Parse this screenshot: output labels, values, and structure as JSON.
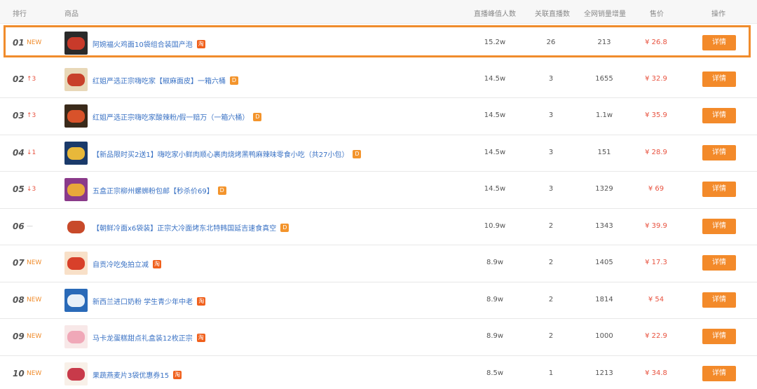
{
  "header": {
    "rank": "排行",
    "product": "商品",
    "peak_viewers": "直播峰值人数",
    "related_lives": "关联直播数",
    "sales_increase": "全网销量增量",
    "price": "售价",
    "action": "操作"
  },
  "detail_label": "详情",
  "colors": {
    "accent": "#f38a2a",
    "highlight_border": "#f08c2c",
    "price": "#e8523f",
    "link": "#3a72c4"
  },
  "rows": [
    {
      "rank": "01",
      "change": "NEW",
      "change_type": "new",
      "name": "阿婉福火鸡面10袋组合装国产泡",
      "badge": "淘",
      "badge_type": "tao",
      "peak": "15.2w",
      "lives": "26",
      "sales": "213",
      "price": "¥ 26.8",
      "thumb": [
        "#2a2a2a",
        "#c83a2a"
      ]
    },
    {
      "rank": "02",
      "change": "↑3",
      "change_type": "up",
      "name": "红姐严选正宗嗨吃家【椒麻面皮】一箱六桶",
      "badge": "D",
      "badge_type": "d",
      "peak": "14.5w",
      "lives": "3",
      "sales": "1655",
      "price": "¥ 32.9",
      "thumb": [
        "#e8d8b8",
        "#c8402a"
      ]
    },
    {
      "rank": "03",
      "change": "↑3",
      "change_type": "up",
      "name": "红姐严选正宗嗨吃家酸辣粉/假一赔万（一箱六桶）",
      "badge": "D",
      "badge_type": "d",
      "peak": "14.5w",
      "lives": "3",
      "sales": "1.1w",
      "price": "¥ 35.9",
      "thumb": [
        "#3a2a1a",
        "#d8522a"
      ]
    },
    {
      "rank": "04",
      "change": "↓1",
      "change_type": "down",
      "name": "【新品限时买2送1】嗨吃家小鲜肉顺心裹肉烧烤黑鸭麻辣味零食小吃（共27小包）",
      "badge": "D",
      "badge_type": "d",
      "peak": "14.5w",
      "lives": "3",
      "sales": "151",
      "price": "¥ 28.9",
      "thumb": [
        "#1a3a6a",
        "#e8b83a"
      ]
    },
    {
      "rank": "05",
      "change": "↓3",
      "change_type": "down",
      "name": "五盒正宗柳州螺蛳粉包邮【秒杀价69】",
      "badge": "D",
      "badge_type": "d",
      "peak": "14.5w",
      "lives": "3",
      "sales": "1329",
      "price": "¥ 69",
      "thumb": [
        "#8a3a8a",
        "#e8a83a"
      ]
    },
    {
      "rank": "06",
      "change": "—",
      "change_type": "flat",
      "name": "【朝鲜冷面x6袋装】正宗大冷面烤东北特韩国延吉速食真空",
      "badge": "D",
      "badge_type": "d",
      "peak": "10.9w",
      "lives": "2",
      "sales": "1343",
      "price": "¥ 39.9",
      "thumb": [
        "#ffffff",
        "#c84a2a"
      ]
    },
    {
      "rank": "07",
      "change": "NEW",
      "change_type": "new",
      "name": "自贡冷吃兔拍立减",
      "badge": "淘",
      "badge_type": "tao",
      "peak": "8.9w",
      "lives": "2",
      "sales": "1405",
      "price": "¥ 17.3",
      "thumb": [
        "#f8e0c8",
        "#d8402a"
      ]
    },
    {
      "rank": "08",
      "change": "NEW",
      "change_type": "new",
      "name": "新西兰进口奶粉 学生青少年中老",
      "badge": "淘",
      "badge_type": "tao",
      "peak": "8.9w",
      "lives": "2",
      "sales": "1814",
      "price": "¥ 54",
      "thumb": [
        "#2a6ab8",
        "#e8f0f8"
      ]
    },
    {
      "rank": "09",
      "change": "NEW",
      "change_type": "new",
      "name": "马卡龙蛋糕甜点礼盒装12枚正宗",
      "badge": "淘",
      "badge_type": "tao",
      "peak": "8.9w",
      "lives": "2",
      "sales": "1000",
      "price": "¥ 22.9",
      "thumb": [
        "#f8e8e8",
        "#f0a8b8"
      ]
    },
    {
      "rank": "10",
      "change": "NEW",
      "change_type": "new",
      "name": "果蔬燕麦片3袋优惠券15",
      "badge": "淘",
      "badge_type": "tao",
      "peak": "8.5w",
      "lives": "1",
      "sales": "1213",
      "price": "¥ 34.8",
      "thumb": [
        "#f8f0e8",
        "#c83a4a"
      ]
    }
  ]
}
